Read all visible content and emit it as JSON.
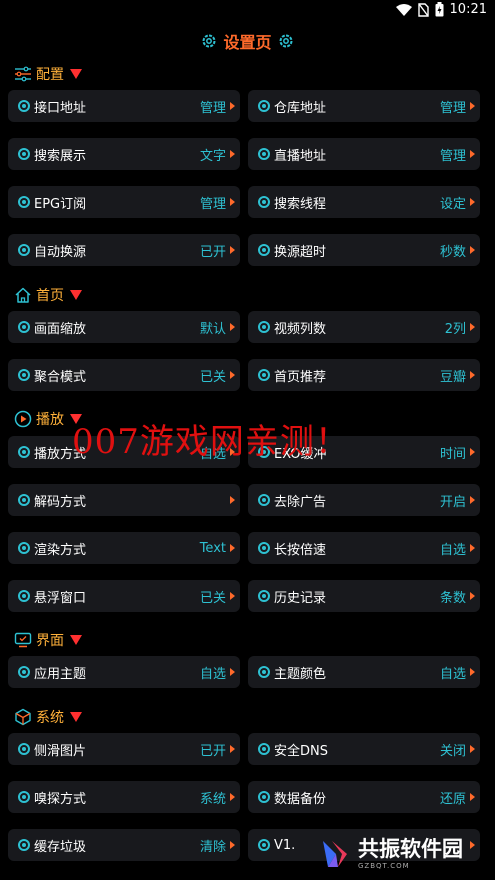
{
  "status": {
    "time": "10:21"
  },
  "title": "设置页",
  "sections": {
    "config": "配置",
    "home": "首页",
    "play": "播放",
    "ui": "界面",
    "system": "系统"
  },
  "items": {
    "api": {
      "label": "接口地址",
      "value": "管理"
    },
    "repo": {
      "label": "仓库地址",
      "value": "管理"
    },
    "search_display": {
      "label": "搜索展示",
      "value": "文字"
    },
    "live": {
      "label": "直播地址",
      "value": "管理"
    },
    "epg": {
      "label": "EPG订阅",
      "value": "管理"
    },
    "search_threads": {
      "label": "搜索线程",
      "value": "设定"
    },
    "auto_switch": {
      "label": "自动换源",
      "value": "已开"
    },
    "switch_timeout": {
      "label": "换源超时",
      "value": "秒数"
    },
    "scale": {
      "label": "画面缩放",
      "value": "默认"
    },
    "columns": {
      "label": "视频列数",
      "value": "2列"
    },
    "aggregate": {
      "label": "聚合模式",
      "value": "已关"
    },
    "recommend": {
      "label": "首页推荐",
      "value": "豆瓣"
    },
    "play_mode": {
      "label": "播放方式",
      "value": "自选"
    },
    "exo_buffer": {
      "label": "EXO缓冲",
      "value": "时间"
    },
    "decode": {
      "label": "解码方式",
      "value": ""
    },
    "remove_ads": {
      "label": "去除广告",
      "value": "开启"
    },
    "render": {
      "label": "渲染方式",
      "value": "Text"
    },
    "long_press": {
      "label": "长按倍速",
      "value": "自选"
    },
    "float_window": {
      "label": "悬浮窗口",
      "value": "已关"
    },
    "history": {
      "label": "历史记录",
      "value": "条数"
    },
    "theme": {
      "label": "应用主题",
      "value": "自选"
    },
    "theme_color": {
      "label": "主题颜色",
      "value": "自选"
    },
    "side_image": {
      "label": "侧滑图片",
      "value": "已开"
    },
    "secure_dns": {
      "label": "安全DNS",
      "value": "关闭"
    },
    "sniff": {
      "label": "嗅探方式",
      "value": "系统"
    },
    "backup": {
      "label": "数据备份",
      "value": "还原"
    },
    "cache": {
      "label": "缓存垃圾",
      "value": "清除"
    },
    "version": {
      "label": "V1.",
      "value": ""
    }
  },
  "watermark": "007游戏网亲测！",
  "logo": {
    "name": "共振软件园",
    "domain": "GZBQT.COM"
  },
  "colors": {
    "accent": "#2ec1d2",
    "title": "#ff6a2b",
    "section": "#ffb13a",
    "triangle": "#ff3030",
    "card": "#18191d"
  }
}
